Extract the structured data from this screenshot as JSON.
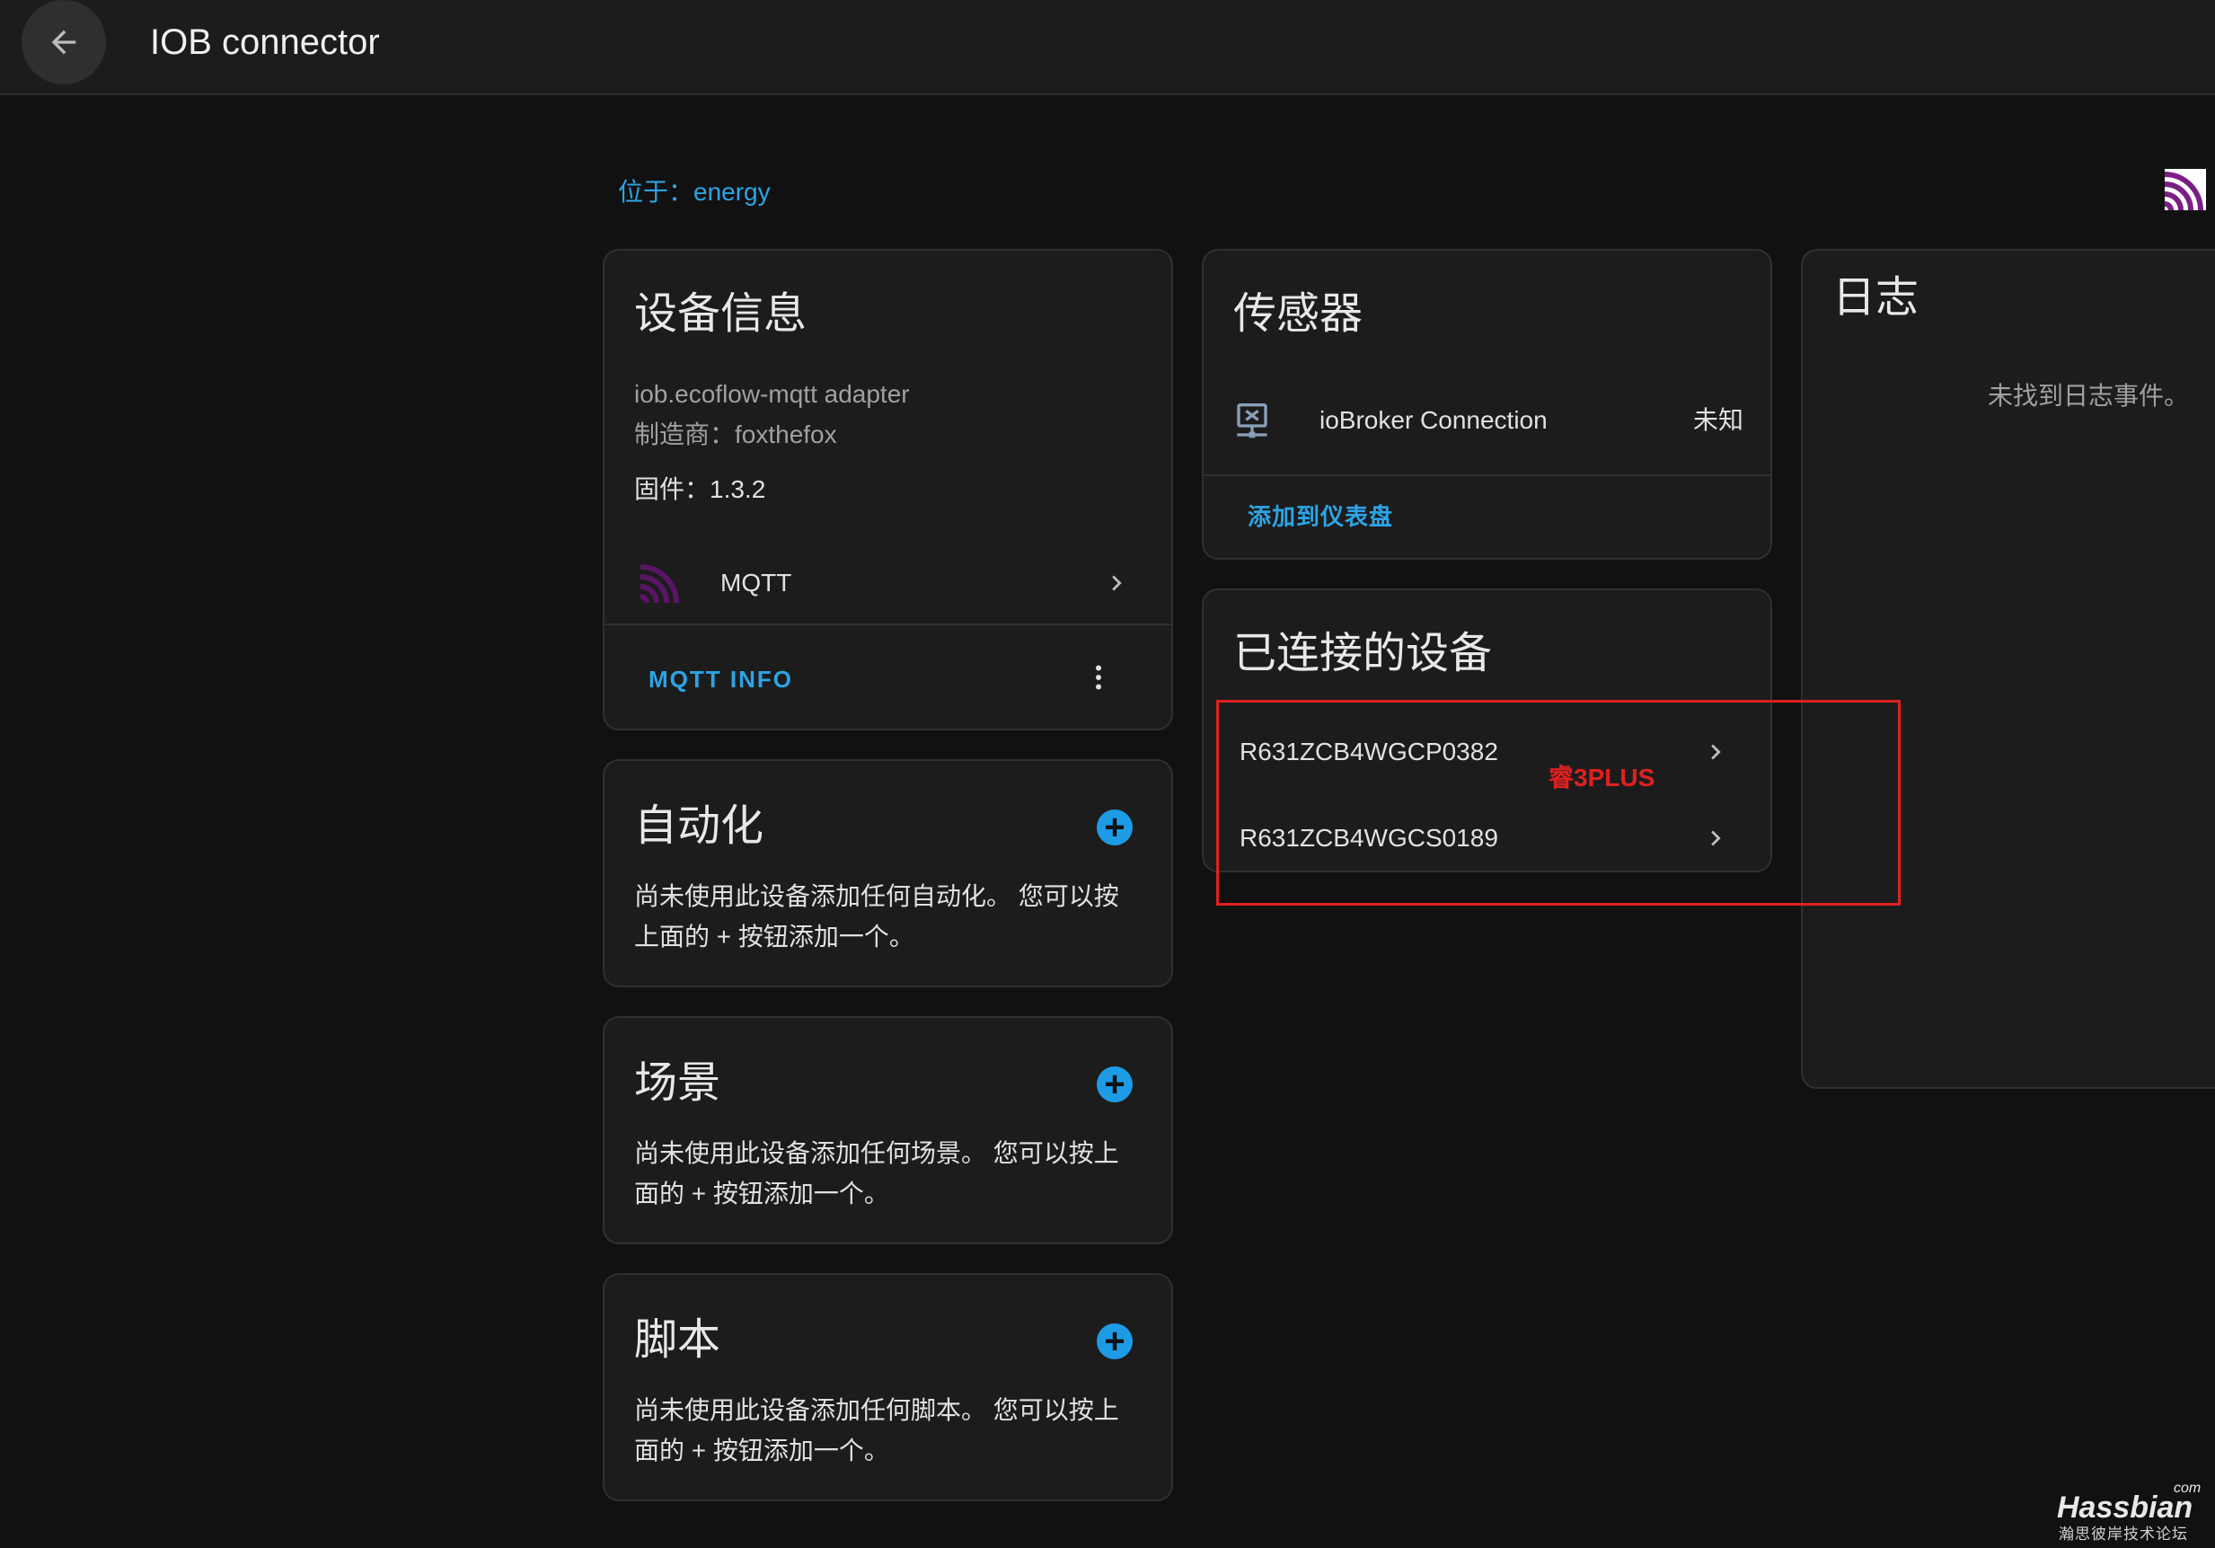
{
  "header": {
    "title": "IOB connector"
  },
  "location": "位于：energy",
  "device_info": {
    "title": "设备信息",
    "model": "iob.ecoflow-mqtt adapter",
    "manufacturer": "制造商：foxthefox",
    "firmware": "固件：1.3.2",
    "integration": "MQTT",
    "action": "MQTT INFO"
  },
  "automation": {
    "title": "自动化",
    "description": "尚未使用此设备添加任何自动化。 您可以按上面的 + 按钮添加一个。"
  },
  "scenes": {
    "title": "场景",
    "description": "尚未使用此设备添加任何场景。 您可以按上面的 + 按钮添加一个。"
  },
  "scripts": {
    "title": "脚本",
    "description": "尚未使用此设备添加任何脚本。 您可以按上面的 + 按钮添加一个。"
  },
  "sensors": {
    "title": "传感器",
    "items": [
      {
        "name": "ioBroker Connection",
        "state": "未知"
      }
    ],
    "add_to_dashboard": "添加到仪表盘"
  },
  "connected_devices": {
    "title": "已连接的设备",
    "items": [
      {
        "name": "R631ZCB4WGCP0382"
      },
      {
        "name": "R631ZCB4WGCS0189"
      }
    ]
  },
  "logbook": {
    "title": "日志",
    "empty": "未找到日志事件。"
  },
  "annotation": {
    "text": "睿3PLUS",
    "color": "#e02020"
  },
  "watermark": {
    "brand": "Hassbian",
    "suffix": "com",
    "tagline": "瀚思彼岸技术论坛"
  },
  "colors": {
    "accent": "#2da4e6",
    "background": "#111111",
    "card": "#1c1c1c",
    "mqtt_icon": "#6b1a78"
  },
  "icons": {
    "back": "arrow-left-icon",
    "mqtt": "mqtt-logo-icon",
    "sensor": "network-icon",
    "add": "plus-circle-icon",
    "chevron": "chevron-right-icon",
    "menu": "dots-vertical-icon"
  }
}
